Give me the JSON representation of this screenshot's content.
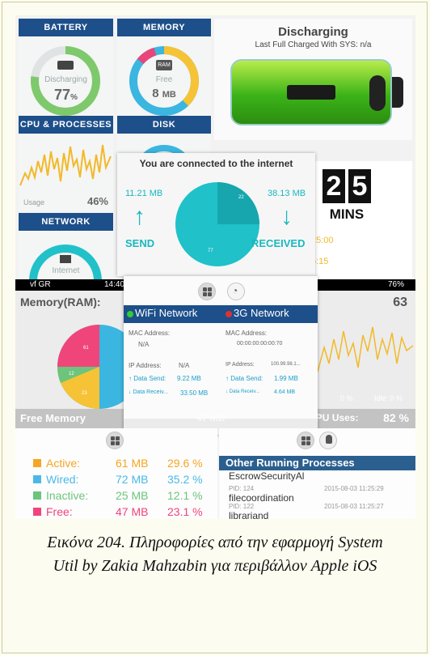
{
  "tiles": {
    "battery": {
      "title": "BATTERY",
      "status": "Discharging",
      "value": "77",
      "unit": "%"
    },
    "memory": {
      "title": "MEMORY",
      "chip": "RAM",
      "status": "Free",
      "value": "8",
      "unit": "MB"
    },
    "cpu": {
      "title": "CPU & PROCESSES",
      "label": "Usage",
      "value": "46%"
    },
    "disk": {
      "title": "DISK"
    },
    "network": {
      "title": "NETWORK",
      "label": "Internet"
    }
  },
  "battery_detail": {
    "title": "Discharging",
    "subtitle": "Last Full Charged With SYS: n/a",
    "mins_digits": [
      "2",
      "5"
    ],
    "mins_label": "MINS",
    "time1": "25:00",
    "time2": "6:15"
  },
  "internet": {
    "title": "You are connected to the internet",
    "send_value": "11.21 MB",
    "send_label": "SEND",
    "received_value": "38.13 MB",
    "received_label": "RECEIVED",
    "pie_small_label": "22",
    "pie_large_label": "77",
    "colors": {
      "pie_main": "#20c1c9",
      "pie_slice": "#17a6ad",
      "accent": "#19b8bf"
    }
  },
  "statusbar_left": {
    "carrier": "vf GR",
    "time": "14:40"
  },
  "statusbar_right": {
    "battery": "76%"
  },
  "ram_panel": {
    "title": "Memory(RAM):",
    "free_label": "Free Memory",
    "free_value": "47 MB",
    "slice_labels": [
      "61",
      "12",
      "23"
    ]
  },
  "network_panel": {
    "wifi": {
      "tab": "WiFi Network",
      "mac_label": "MAC Address:",
      "mac_value": "N/A",
      "ip_label": "IP Address:",
      "ip_value": "N/A",
      "send_label": "Data Send:",
      "send_value": "9.22 MB",
      "recv_label": "Data Receiv...",
      "recv_value": "33.50 MB"
    },
    "cell": {
      "tab": "3G Network",
      "mac_label": "MAC Address:",
      "mac_value": "00:00:00:00:00:70",
      "ip_label": "IP Address:",
      "ip_value": "100.99.98.1...",
      "send_label": "Data Send:",
      "send_value": "1.99 MB",
      "recv_label": "Data Receiv...",
      "recv_value": "4.64 MB"
    },
    "colors": {
      "header": "#1d4f8a",
      "wifi_dot": "#33cc33",
      "cell_dot": "#e03030",
      "text": "#1aa0c8"
    }
  },
  "cpu_panel": {
    "value_top": "63",
    "legend_left": "0 %",
    "legend_right": "Idle: 0 %",
    "total_label": "Total CPU Uses:",
    "total_value": "82 %"
  },
  "memory_table": {
    "rows": [
      {
        "name": "Active:",
        "mb": "61 MB",
        "pct": "29.6 %",
        "color": "#f5a623"
      },
      {
        "name": "Wired:",
        "mb": "72 MB",
        "pct": "35.2 %",
        "color": "#4ab9e8"
      },
      {
        "name": "Inactive:",
        "mb": "25 MB",
        "pct": "12.1 %",
        "color": "#6dc47c"
      },
      {
        "name": "Free:",
        "mb": "47 MB",
        "pct": "23.1 %",
        "color": "#f0457a"
      }
    ]
  },
  "processes": {
    "header": "Other Running Processes",
    "items": [
      {
        "pid": "",
        "time": "",
        "name": "EscrowSecurityAl"
      },
      {
        "pid": "PID: 124",
        "time": "2015-08-03 11:25:29",
        "name": "filecoordination"
      },
      {
        "pid": "PID: 122",
        "time": "2015-08-03 11:25:27",
        "name": "librariand"
      }
    ]
  },
  "caption": {
    "line1": "Εικόνα 204. Πληροφορίες από την εφαρμογή System",
    "line2": "Util by Zakia Mahzabin για περιβάλλον Apple iOS"
  }
}
